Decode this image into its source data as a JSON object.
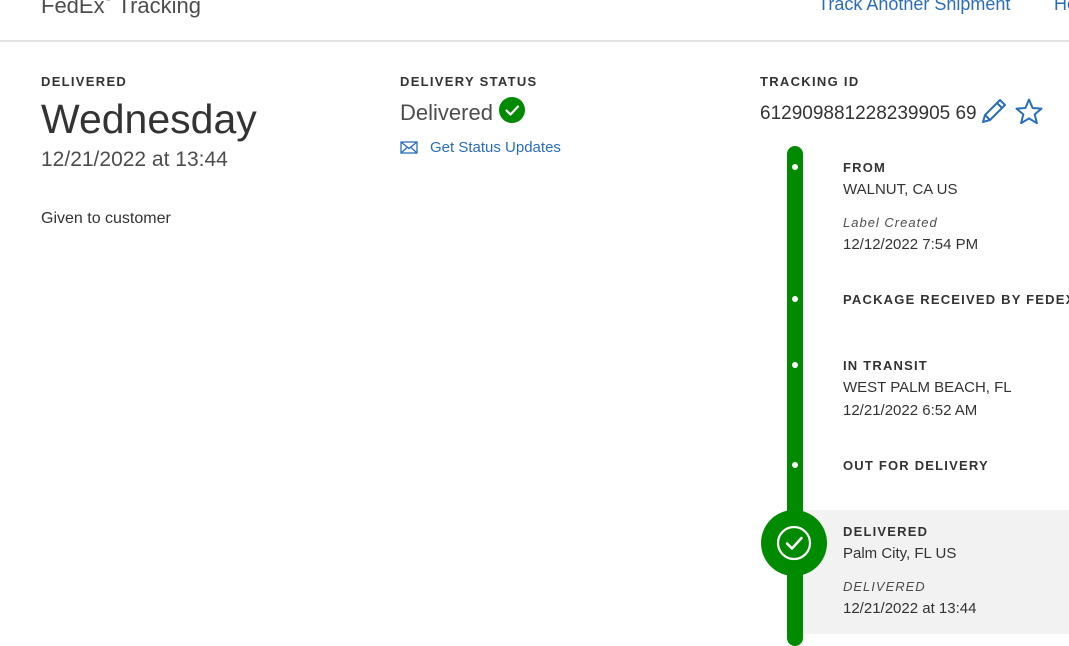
{
  "header": {
    "brand_main": "FedEx",
    "brand_mark": "®",
    "brand_suffix": "Tracking",
    "track_another": "Track Another Shipment",
    "cut_link": "He"
  },
  "delivered": {
    "label": "DELIVERED",
    "day": "Wednesday",
    "datetime": "12/21/2022 at 13:44",
    "detail": "Given to customer"
  },
  "delivery_status": {
    "label": "DELIVERY STATUS",
    "value": "Delivered",
    "status_icon": "check-circle-icon",
    "updates_link": "Get Status Updates",
    "updates_icon": "envelope-icon"
  },
  "tracking": {
    "label": "TRACKING ID",
    "number": "612909881228239905 69",
    "edit_icon": "pencil-icon",
    "favorite_icon": "star-icon"
  },
  "timeline": {
    "events": [
      {
        "title": "FROM",
        "location": "WALNUT, CA US",
        "sub_label": "Label Created",
        "time": "12/12/2022 7:54 PM"
      },
      {
        "title": "PACKAGE RECEIVED BY FEDEX"
      },
      {
        "title": "IN TRANSIT",
        "location": "WEST PALM BEACH, FL",
        "time": "12/21/2022 6:52 AM"
      },
      {
        "title": "OUT FOR DELIVERY"
      },
      {
        "title": "DELIVERED",
        "location": "Palm City, FL US",
        "sub_label": "DELIVERED",
        "time": "12/21/2022 at 13:44"
      }
    ]
  },
  "colors": {
    "accent_green": "#008a00",
    "link_blue": "#2a6ebb",
    "highlight_bg": "#f2f2f2"
  }
}
